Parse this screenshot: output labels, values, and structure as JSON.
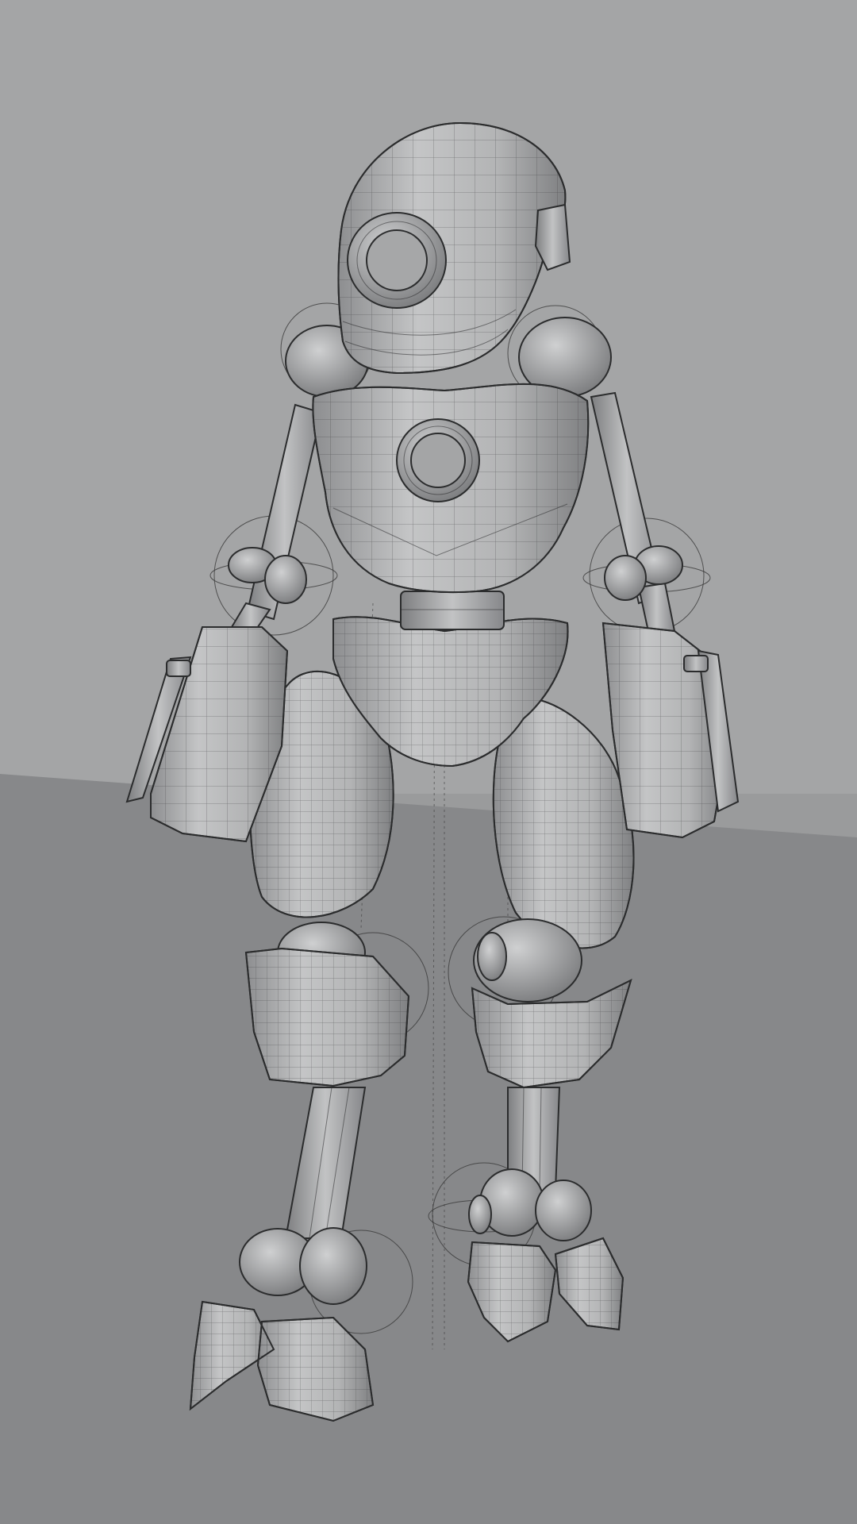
{
  "viewport": {
    "background_color": "#a4a5a6",
    "floor_color": "#87888a",
    "model_color": "#b9babb",
    "model_shade": "#8f9092",
    "wire_color": "#2b2c2d",
    "display_mode": "wireframe-on-shaded"
  },
  "model": {
    "subject": "robot",
    "parts": [
      "head",
      "eye-socket",
      "torso",
      "chest-port",
      "neck",
      "pelvis",
      "left-arm",
      "right-arm",
      "left-forearm-block",
      "right-forearm-block",
      "left-thigh",
      "right-thigh",
      "left-knee-guard",
      "right-knee-guard",
      "left-shin",
      "right-shin",
      "left-foot",
      "right-foot"
    ],
    "rig_controls": [
      "shoulder-control-left",
      "shoulder-control-right",
      "elbow-control-left",
      "elbow-control-right",
      "knee-control-left",
      "knee-control-right",
      "ankle-control-left",
      "ankle-control-right"
    ]
  }
}
